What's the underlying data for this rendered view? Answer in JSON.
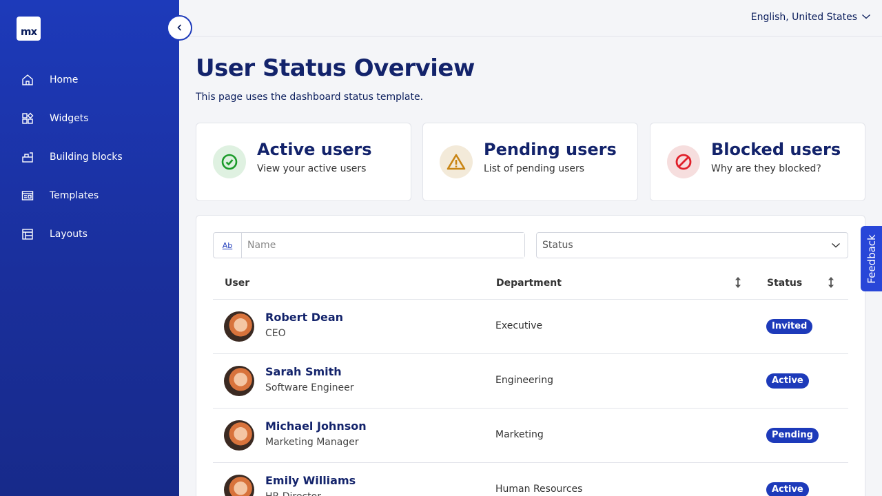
{
  "app": {
    "logo_text": "mx"
  },
  "sidebar": {
    "items": [
      {
        "label": "Home",
        "icon": "home-icon"
      },
      {
        "label": "Widgets",
        "icon": "widgets-icon"
      },
      {
        "label": "Building blocks",
        "icon": "building-blocks-icon"
      },
      {
        "label": "Templates",
        "icon": "templates-icon"
      },
      {
        "label": "Layouts",
        "icon": "layouts-icon"
      }
    ]
  },
  "topbar": {
    "language": "English, United States"
  },
  "page": {
    "title": "User Status Overview",
    "subtitle": "This page uses the dashboard status template."
  },
  "cards": [
    {
      "title": "Active users",
      "subtitle": "View your active users",
      "icon": "check-circle-icon",
      "color": "#1c9b2a",
      "bg": "#dff1e1"
    },
    {
      "title": "Pending users",
      "subtitle": "List of pending users",
      "icon": "warning-icon",
      "color": "#c98514",
      "bg": "#f3ead9"
    },
    {
      "title": "Blocked users",
      "subtitle": "Why are they blocked?",
      "icon": "blocked-icon",
      "color": "#e0202a",
      "bg": "#f6dede"
    }
  ],
  "filters": {
    "name_toggle": "Ab",
    "name_placeholder": "Name",
    "status_placeholder": "Status"
  },
  "table": {
    "columns": [
      "User",
      "Department",
      "Status"
    ],
    "rows": [
      {
        "name": "Robert Dean",
        "role": "CEO",
        "department": "Executive",
        "status": "Invited"
      },
      {
        "name": "Sarah Smith",
        "role": "Software Engineer",
        "department": "Engineering",
        "status": "Active"
      },
      {
        "name": "Michael Johnson",
        "role": "Marketing Manager",
        "department": "Marketing",
        "status": "Pending"
      },
      {
        "name": "Emily Williams",
        "role": "HR Director",
        "department": "Human Resources",
        "status": "Active"
      }
    ]
  },
  "feedback_label": "Feedback",
  "colors": {
    "accent": "#1d3aba",
    "title": "#13236b"
  }
}
